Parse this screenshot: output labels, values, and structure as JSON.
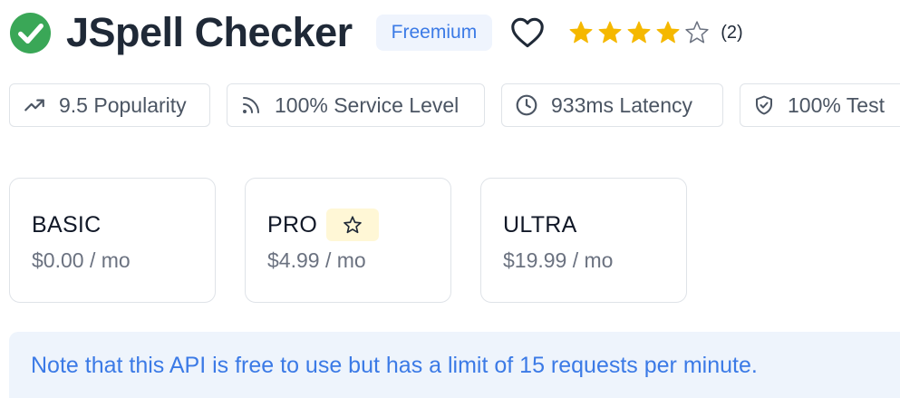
{
  "header": {
    "title": "JSpell Checker",
    "badge": "Freemium",
    "rating": 4,
    "rating_max": 5,
    "rating_count": "(2)"
  },
  "stats": [
    {
      "label": "9.5 Popularity",
      "icon": "trending-up-icon"
    },
    {
      "label": "100% Service Level",
      "icon": "signal-icon"
    },
    {
      "label": "933ms Latency",
      "icon": "clock-icon"
    },
    {
      "label": "100% Test",
      "icon": "shield-check-icon"
    }
  ],
  "plans": [
    {
      "name": "BASIC",
      "price": "$0.00 / mo",
      "recommended": false
    },
    {
      "name": "PRO",
      "price": "$4.99 / mo",
      "recommended": true
    },
    {
      "name": "ULTRA",
      "price": "$19.99 / mo",
      "recommended": false
    }
  ],
  "note": "Note that this API is free to use but has a limit of 15 requests per minute.",
  "colors": {
    "verified": "#3aa757",
    "star": "#f5b800",
    "accent": "#3b7ae6",
    "badge_bg": "#eff4fd",
    "note_bg": "#eef4fc"
  }
}
